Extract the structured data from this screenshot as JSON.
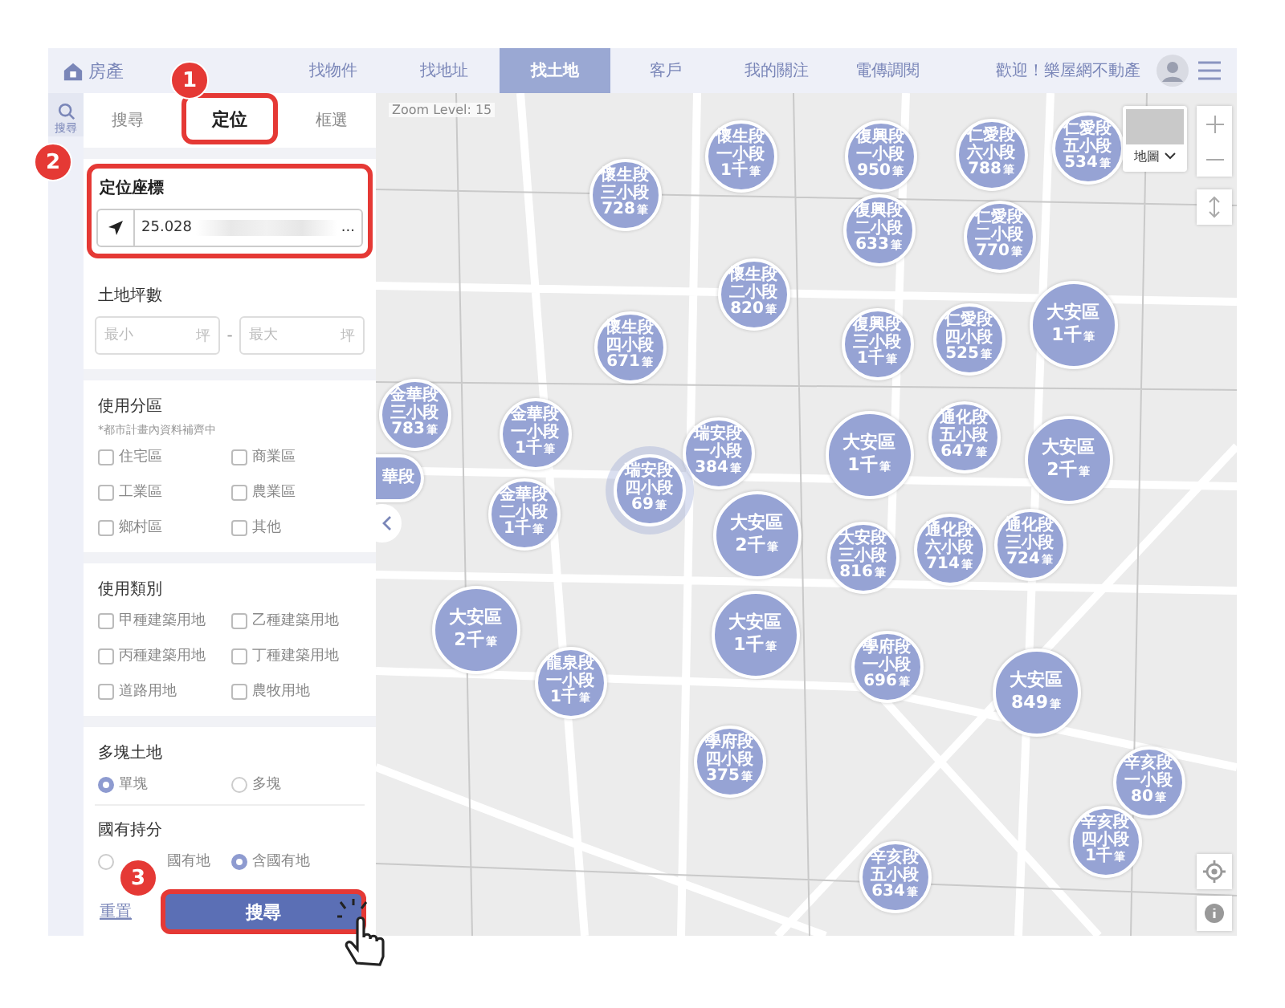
{
  "top_bar": {
    "logo": "房產",
    "nav": [
      {
        "label": "找物件",
        "selected": false
      },
      {
        "label": "找地址",
        "selected": false
      },
      {
        "label": "找土地",
        "selected": true
      },
      {
        "label": "客戶",
        "selected": false
      },
      {
        "label": "我的關注",
        "selected": false
      },
      {
        "label": "電傳調閱",
        "selected": false
      }
    ],
    "greeting": "歡迎！樂屋網不動產"
  },
  "side_strip": {
    "label": "搜尋"
  },
  "panel": {
    "tabs": [
      {
        "label": "搜尋",
        "selected": false
      },
      {
        "label": "定位",
        "selected": true
      },
      {
        "label": "框選",
        "selected": false
      }
    ],
    "coords": {
      "title": "定位座標",
      "value": "25.028",
      "ellipsis": "..."
    },
    "area": {
      "title": "土地坪數",
      "min": {
        "placeholder": "最小",
        "unit": "坪"
      },
      "separator": "-",
      "max": {
        "placeholder": "最大",
        "unit": "坪"
      }
    },
    "zoning": {
      "title": "使用分區",
      "note": "*都市計畫內資料補齊中",
      "options": [
        {
          "label": "住宅區",
          "checked": false
        },
        {
          "label": "商業區",
          "checked": false
        },
        {
          "label": "工業區",
          "checked": false
        },
        {
          "label": "農業區",
          "checked": false
        },
        {
          "label": "鄉村區",
          "checked": false
        },
        {
          "label": "其他",
          "checked": false
        }
      ]
    },
    "category": {
      "title": "使用類別",
      "options": [
        {
          "label": "甲種建築用地",
          "checked": false
        },
        {
          "label": "乙種建築用地",
          "checked": false
        },
        {
          "label": "丙種建築用地",
          "checked": false
        },
        {
          "label": "丁種建築用地",
          "checked": false
        },
        {
          "label": "道路用地",
          "checked": false
        },
        {
          "label": "農牧用地",
          "checked": false
        }
      ]
    },
    "multi_parcel": {
      "title": "多塊土地",
      "options": [
        {
          "label": "單塊",
          "selected": true
        },
        {
          "label": "多塊",
          "selected": false
        }
      ]
    },
    "state_share": {
      "title": "國有持分",
      "options": [
        {
          "label": "國有地",
          "selected": false
        },
        {
          "label": "含國有地",
          "selected": true
        }
      ]
    },
    "reset": "重置",
    "search": "搜尋"
  },
  "map": {
    "zoom_label": "Zoom Level: 15",
    "map_type": "地圖",
    "clusters": [
      {
        "kind": "section",
        "lines": [
          "懷生段",
          "三小段"
        ],
        "count": "728",
        "unit": "筆",
        "highlighted": false
      },
      {
        "kind": "section",
        "lines": [
          "懷生段",
          "一小段"
        ],
        "count": "1千",
        "unit": "筆",
        "highlighted": false
      },
      {
        "kind": "section",
        "lines": [
          "復興段",
          "一小段"
        ],
        "count": "950",
        "unit": "筆",
        "highlighted": false
      },
      {
        "kind": "section",
        "lines": [
          "仁愛段",
          "六小段"
        ],
        "count": "788",
        "unit": "筆",
        "highlighted": false
      },
      {
        "kind": "section",
        "lines": [
          "仁愛段",
          "五小段"
        ],
        "count": "534",
        "unit": "筆",
        "highlighted": false
      },
      {
        "kind": "section",
        "lines": [
          "懷生段",
          "二小段"
        ],
        "count": "820",
        "unit": "筆",
        "highlighted": false
      },
      {
        "kind": "section",
        "lines": [
          "復興段",
          "二小段"
        ],
        "count": "633",
        "unit": "筆",
        "highlighted": false
      },
      {
        "kind": "section",
        "lines": [
          "仁愛段",
          "二小段"
        ],
        "count": "770",
        "unit": "筆",
        "highlighted": false
      },
      {
        "kind": "section",
        "lines": [
          "懷生段",
          "四小段"
        ],
        "count": "671",
        "unit": "筆",
        "highlighted": false
      },
      {
        "kind": "section",
        "lines": [
          "復興段",
          "三小段"
        ],
        "count": "1千",
        "unit": "筆",
        "highlighted": false
      },
      {
        "kind": "section",
        "lines": [
          "仁愛段",
          "四小段"
        ],
        "count": "525",
        "unit": "筆",
        "highlighted": false
      },
      {
        "kind": "district",
        "lines": [
          "大安區"
        ],
        "count": "1千",
        "unit": "筆",
        "highlighted": false
      },
      {
        "kind": "section",
        "lines": [
          "金華段",
          "三小段"
        ],
        "count": "783",
        "unit": "筆",
        "highlighted": false
      },
      {
        "kind": "section",
        "lines": [
          "金華段",
          "一小段"
        ],
        "count": "1千",
        "unit": "筆",
        "highlighted": false
      },
      {
        "kind": "section",
        "lines": [
          "瑞安段",
          "一小段"
        ],
        "count": "384",
        "unit": "筆",
        "highlighted": false
      },
      {
        "kind": "district",
        "lines": [
          "大安區"
        ],
        "count": "1千",
        "unit": "筆",
        "highlighted": false
      },
      {
        "kind": "section",
        "lines": [
          "通化段",
          "五小段"
        ],
        "count": "647",
        "unit": "筆",
        "highlighted": false
      },
      {
        "kind": "district",
        "lines": [
          "大安區"
        ],
        "count": "2千",
        "unit": "筆",
        "highlighted": false
      },
      {
        "kind": "edge",
        "lines": [
          "華段"
        ],
        "highlighted": false
      },
      {
        "kind": "section",
        "lines": [
          "瑞安段",
          "四小段"
        ],
        "count": "69",
        "unit": "筆",
        "highlighted": true
      },
      {
        "kind": "section",
        "lines": [
          "金華段",
          "二小段"
        ],
        "count": "1千",
        "unit": "筆",
        "highlighted": false
      },
      {
        "kind": "district",
        "lines": [
          "大安區"
        ],
        "count": "2千",
        "unit": "筆",
        "highlighted": false
      },
      {
        "kind": "section",
        "lines": [
          "大安段",
          "三小段"
        ],
        "count": "816",
        "unit": "筆",
        "highlighted": false
      },
      {
        "kind": "section",
        "lines": [
          "通化段",
          "六小段"
        ],
        "count": "714",
        "unit": "筆",
        "highlighted": false
      },
      {
        "kind": "section",
        "lines": [
          "通化段",
          "三小段"
        ],
        "count": "724",
        "unit": "筆",
        "highlighted": false
      },
      {
        "kind": "district",
        "lines": [
          "大安區"
        ],
        "count": "2千",
        "unit": "筆",
        "highlighted": false
      },
      {
        "kind": "district",
        "lines": [
          "大安區"
        ],
        "count": "1千",
        "unit": "筆",
        "highlighted": false
      },
      {
        "kind": "section",
        "lines": [
          "龍泉段",
          "一小段"
        ],
        "count": "1千",
        "unit": "筆",
        "highlighted": false
      },
      {
        "kind": "section",
        "lines": [
          "學府段",
          "一小段"
        ],
        "count": "696",
        "unit": "筆",
        "highlighted": false
      },
      {
        "kind": "district",
        "lines": [
          "大安區"
        ],
        "count": "849",
        "unit": "筆",
        "highlighted": false
      },
      {
        "kind": "section",
        "lines": [
          "學府段",
          "四小段"
        ],
        "count": "375",
        "unit": "筆",
        "highlighted": false
      },
      {
        "kind": "section",
        "lines": [
          "辛亥段",
          "一小段"
        ],
        "count": "80",
        "unit": "筆",
        "highlighted": false
      },
      {
        "kind": "section",
        "lines": [
          "辛亥段",
          "四小段"
        ],
        "count": "1千",
        "unit": "筆",
        "highlighted": false
      },
      {
        "kind": "section",
        "lines": [
          "辛亥段",
          "五小段"
        ],
        "count": "634",
        "unit": "筆",
        "highlighted": false
      }
    ]
  },
  "callouts": [
    "1",
    "2",
    "3"
  ]
}
